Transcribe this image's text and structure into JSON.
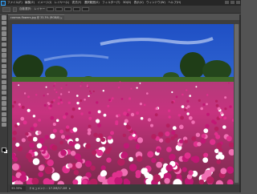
{
  "app": {
    "menu": [
      "ファイル(F)",
      "編集(E)",
      "イメージ(I)",
      "レイヤー(L)",
      "書式(Y)",
      "選択範囲(S)",
      "フィルター(T)",
      "3D(D)",
      "表示(V)",
      "ウィンドウ(W)",
      "ヘルプ(H)"
    ],
    "accent": "#31a8ff"
  },
  "options": {
    "auto_select_label": "自動選択:",
    "auto_select_value": "レイヤー"
  },
  "document": {
    "tab_label": "cosmos-flowers.jpg @ 33.3% (RGB/8)",
    "close_symbol": "×"
  },
  "status": {
    "zoom": "33.33%",
    "doc_info": "ドキュメント : 17.2M/17.2M",
    "arrow": "▸"
  },
  "photo": {
    "subject": "cosmos-field-landscape",
    "sky_color": "#2f63d6",
    "flower_colors": [
      "#e0308d",
      "#c21875",
      "#f06fb3",
      "#ffffff",
      "#b51f60"
    ]
  }
}
